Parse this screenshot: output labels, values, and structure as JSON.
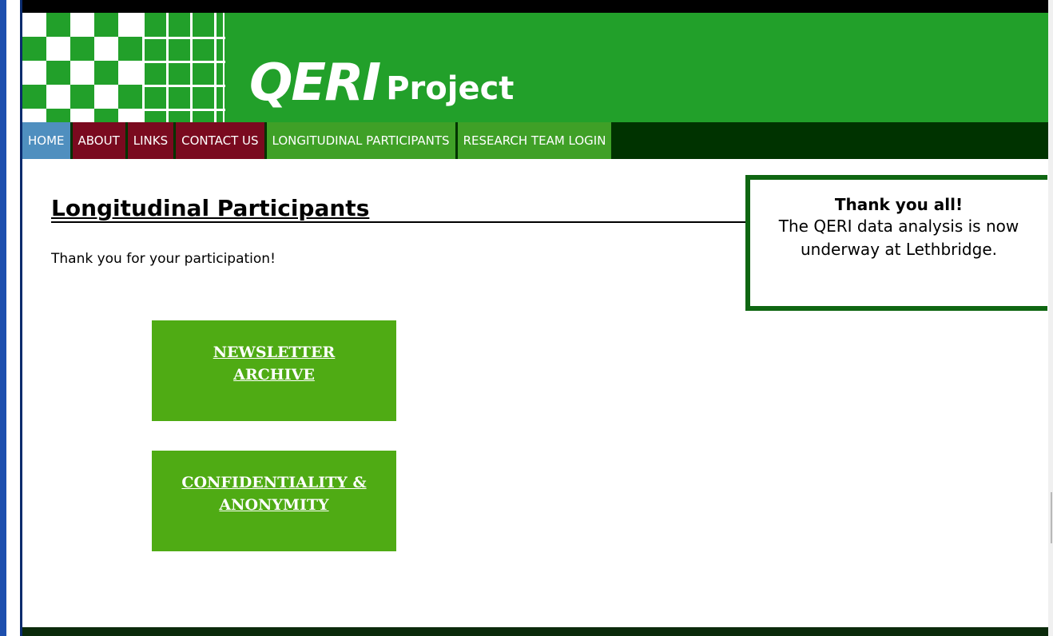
{
  "header": {
    "logo_mark": "QERI",
    "logo_word": "Project"
  },
  "nav": {
    "items": [
      {
        "label": "HOME",
        "style": "home"
      },
      {
        "label": "ABOUT",
        "style": "maroon"
      },
      {
        "label": "LINKS",
        "style": "maroon"
      },
      {
        "label": "CONTACT US",
        "style": "maroon"
      },
      {
        "label": "LONGITUDINAL PARTICIPANTS",
        "style": "green"
      },
      {
        "label": "RESEARCH TEAM LOGIN",
        "style": "green"
      }
    ]
  },
  "main": {
    "title": "Longitudinal Participants",
    "intro": "Thank you for your participation!",
    "tiles": [
      {
        "label": "NEWSLETTER ARCHIVE"
      },
      {
        "label": "CONFIDENTIALITY & ANONYMITY"
      }
    ]
  },
  "notice": {
    "title": "Thank you all!",
    "body": "The QERI data analysis is now underway at Lethbridge."
  },
  "colors": {
    "header_green": "#22a02a",
    "nav_dark": "#003300",
    "home_blue": "#4f8fbf",
    "maroon": "#7a0a1f",
    "nav_green": "#3fa027",
    "tile_green": "#4fab14",
    "notice_border": "#0f6612"
  }
}
